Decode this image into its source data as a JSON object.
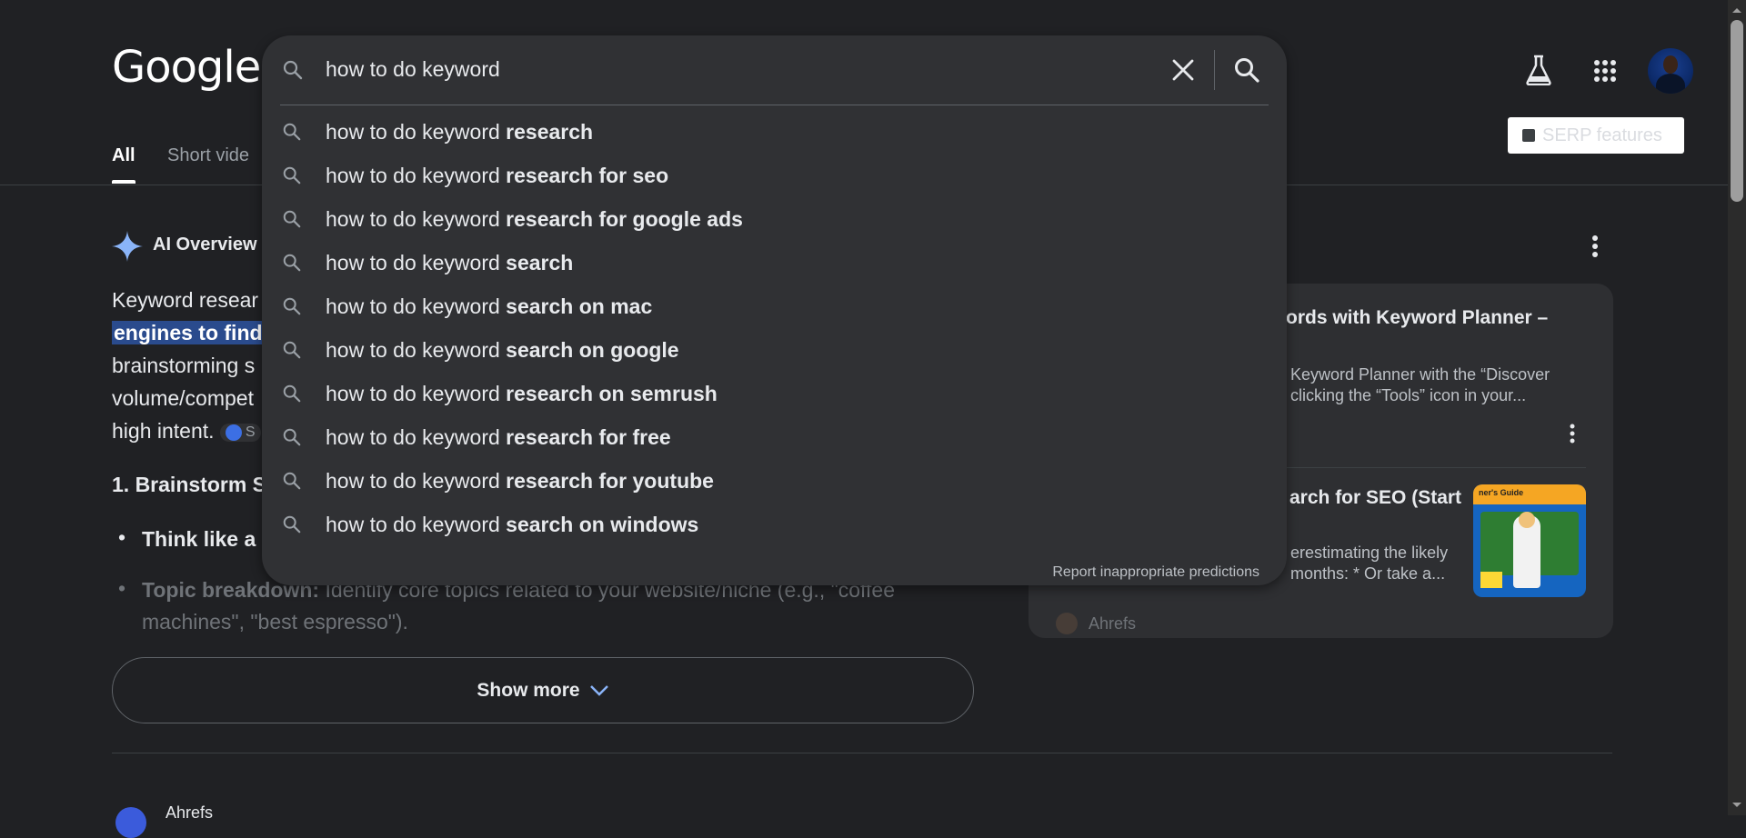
{
  "header": {
    "logo": "Google",
    "labs_icon": "flask-icon",
    "apps_icon": "apps-grid-icon",
    "serp_features_label": "SERP features"
  },
  "tabs": [
    {
      "label": "All"
    },
    {
      "label": "Short vide"
    }
  ],
  "ai_overview": {
    "title": "AI Overview",
    "lines": [
      "Keyword resear",
      "engines to find",
      "brainstorming s",
      "volume/compet",
      "high intent."
    ],
    "chip_label": "S",
    "heading": "1. Brainstorm S",
    "bullet_1": "Think like a",
    "bullet_2_bold": "Topic breakdown:",
    "bullet_2_rest": " Identify core topics related to your website/niche (e.g., \"coffee",
    "bullet_2_cont": "machines\", \"best espresso\").",
    "show_more": "Show more"
  },
  "second_result": {
    "site_name": "Ahrefs"
  },
  "right_panel": {
    "card1_title": "ords with Keyword Planner –",
    "card1_snippet_1": "Keyword Planner with the “Discover",
    "card1_snippet_2": "clicking the “Tools” icon in your...",
    "card2_title": "arch for SEO (Start",
    "card2_snippet_1": "erestimating the likely",
    "card2_snippet_2": "months: * Or take a...",
    "card2_thumb_text": "ner's Guide",
    "card3_source": "Ahrefs"
  },
  "search": {
    "query": "how to do keyword",
    "suggestions": [
      {
        "prefix": "how to do keyword ",
        "completion": "research"
      },
      {
        "prefix": "how to do keyword ",
        "completion": "research for seo"
      },
      {
        "prefix": "how to do keyword ",
        "completion": "research for google ads"
      },
      {
        "prefix": "how to do keyword ",
        "completion": "search"
      },
      {
        "prefix": "how to do keyword ",
        "completion": "search on mac"
      },
      {
        "prefix": "how to do keyword ",
        "completion": "search on google"
      },
      {
        "prefix": "how to do keyword ",
        "completion": "research on semrush"
      },
      {
        "prefix": "how to do keyword ",
        "completion": "research for free"
      },
      {
        "prefix": "how to do keyword ",
        "completion": "research for youtube"
      },
      {
        "prefix": "how to do keyword ",
        "completion": "search on windows"
      }
    ],
    "report_link": "Report inappropriate predictions"
  },
  "colors": {
    "background": "#202124",
    "dropdown": "#303134",
    "highlight": "#2a4b8d",
    "ai_star": "#8ab4f8"
  }
}
